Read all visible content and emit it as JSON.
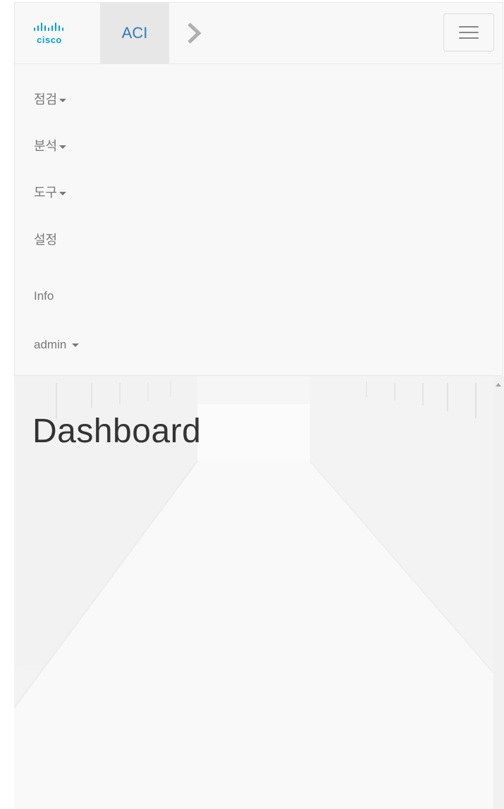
{
  "navbar": {
    "brand": {
      "logo_text": "cisco",
      "label": "ACI"
    },
    "chevron_icon": "chevron-right-icon",
    "toggle_icon": "hamburger-menu-icon",
    "menu": [
      {
        "label": "점검",
        "has_dropdown": true
      },
      {
        "label": "분석",
        "has_dropdown": true
      },
      {
        "label": "도구",
        "has_dropdown": true
      },
      {
        "label": "설정",
        "has_dropdown": false
      },
      {
        "label": "Info",
        "has_dropdown": false
      },
      {
        "label": "admin",
        "has_dropdown": true
      }
    ]
  },
  "main": {
    "title": "Dashboard"
  },
  "colors": {
    "navbar_bg": "#f8f8f8",
    "brand_active_bg": "#e7e7e7",
    "brand_text": "#337ab7",
    "logo_blue": "#049fd9",
    "menu_text": "#777777",
    "title_text": "#333333"
  }
}
